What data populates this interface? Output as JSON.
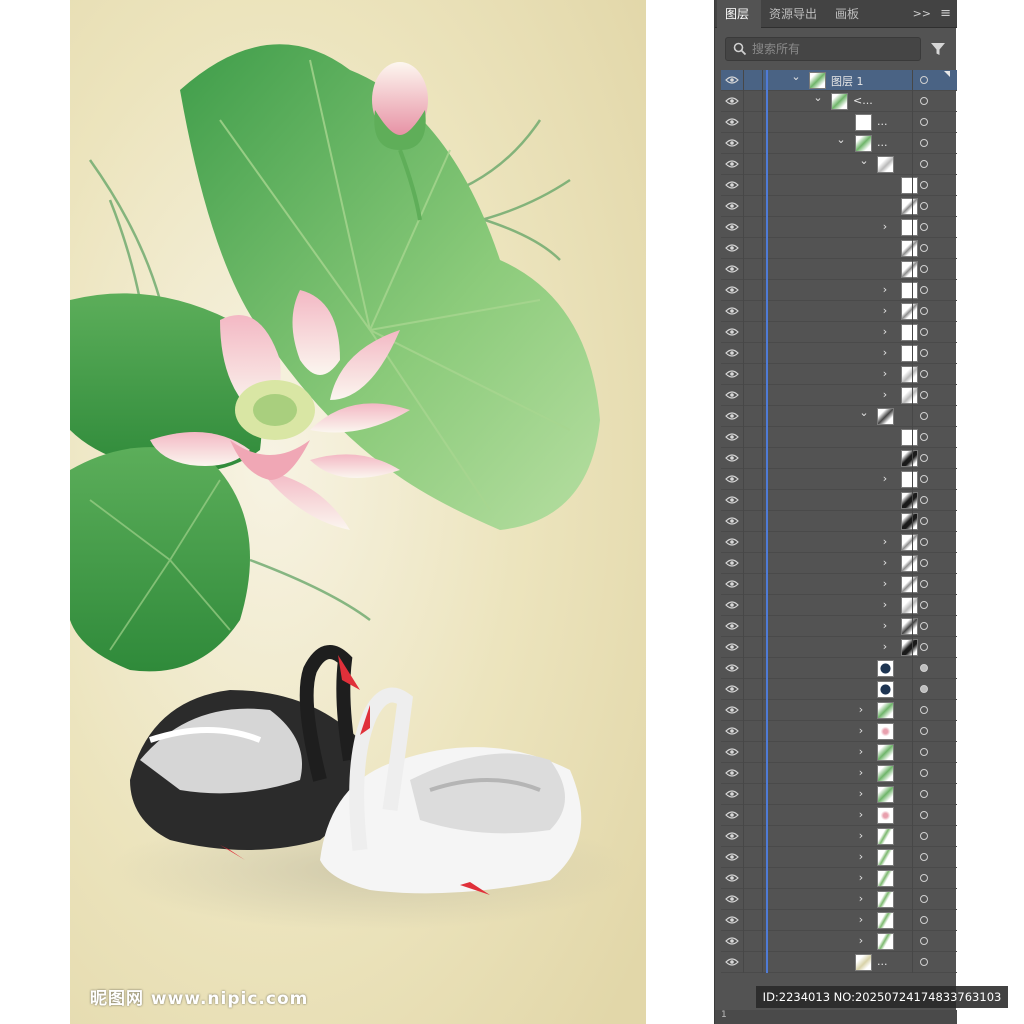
{
  "watermark": {
    "text": "昵图网 www.nipic.com"
  },
  "panel": {
    "tabs": [
      {
        "label": "图层"
      },
      {
        "label": "资源导出"
      },
      {
        "label": "画板"
      }
    ],
    "expand_glyph": ">>",
    "menu_glyph": "≡",
    "search": {
      "placeholder": "搜索所有"
    },
    "layer_name": "图层 1",
    "sublayer_name": "<...",
    "ellipsis": "...",
    "footer_count": "1"
  },
  "overlay": {
    "id_text": "ID:2234013 NO:20250724174833763103"
  },
  "colors": {
    "panel_bg": "#535353",
    "selection": "#4a6384",
    "layer_color": "#4f7bd6",
    "background_cream": "#efe5bd"
  },
  "icons": {
    "visibility": "eye-icon",
    "search": "magnifier-icon",
    "filter": "funnel-icon",
    "expand": "chevron-right-icon",
    "collapse": "chevron-down-icon"
  }
}
